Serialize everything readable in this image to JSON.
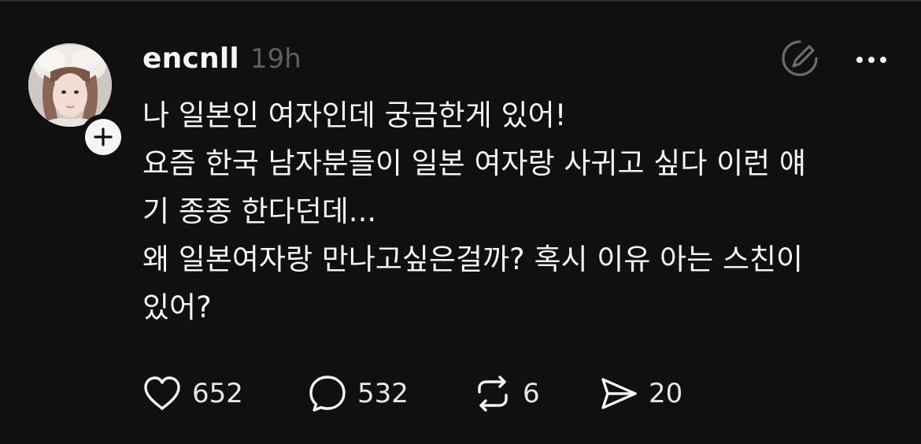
{
  "post": {
    "username": "encnll",
    "timestamp": "19h",
    "text_lines": [
      "나 일본인 여자인데 궁금한게 있어!",
      "요즘 한국 남자분들이 일본 여자랑 사귀고 싶다 이런 얘",
      "기 종종 한다던데...",
      "왜 일본여자랑 만나고싶은걸까? 혹시 이유 아는 스친이",
      "있어?"
    ],
    "stats": {
      "likes": "652",
      "replies": "532",
      "reposts": "6",
      "shares": "20"
    },
    "icons": {
      "avatar": "profile-photo",
      "follow": "plus-icon",
      "edit": "edit-circle-icon",
      "more": "ellipsis-icon",
      "like": "heart-icon",
      "reply": "speech-bubble-icon",
      "repost": "repost-arrows-icon",
      "share": "paper-plane-icon"
    },
    "colors": {
      "background": "#101010",
      "text": "#f3f5f7",
      "muted": "#5e5e5e"
    }
  }
}
